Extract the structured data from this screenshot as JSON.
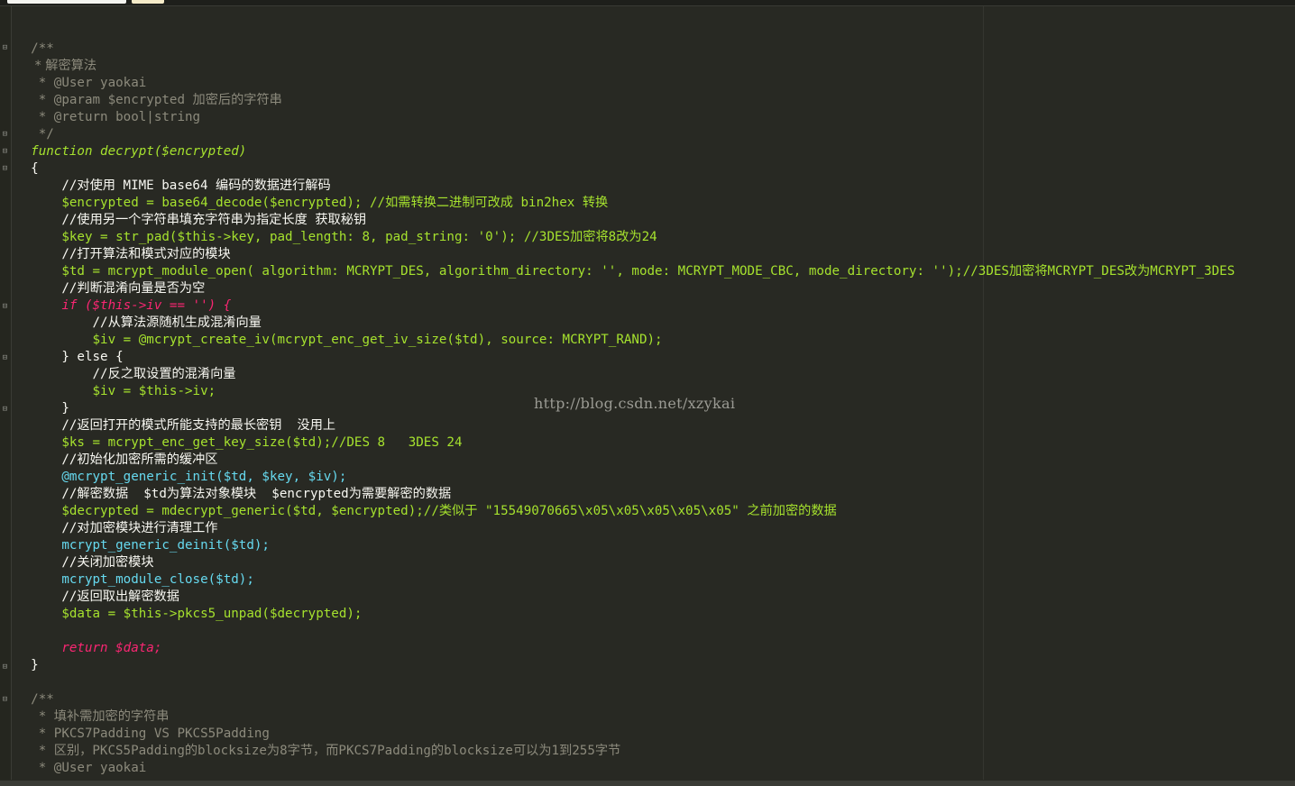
{
  "editor": {
    "tabs": [
      "",
      ""
    ],
    "watermark": "http://blog.csdn.net/xzykai"
  },
  "code": {
    "lines": [
      "/**",
      " * 解密算法",
      " * @User yaokai",
      " * @param $encrypted 加密后的字符串",
      " * @return bool|string",
      " */",
      "function decrypt($encrypted)",
      "{",
      "    //对使用 MIME base64 编码的数据进行解码",
      "    $encrypted = base64_decode($encrypted); //如需转换二进制可改成 bin2hex 转换",
      "    //使用另一个字符串填充字符串为指定长度 获取秘钥",
      "    $key = str_pad($this->key, pad_length: 8, pad_string: '0'); //3DES加密将8改为24",
      "    //打开算法和模式对应的模块",
      "    $td = mcrypt_module_open( algorithm: MCRYPT_DES, algorithm_directory: '', mode: MCRYPT_MODE_CBC, mode_directory: '');//3DES加密将MCRYPT_DES改为MCRYPT_3DES",
      "    //判断混淆向量是否为空",
      "    if ($this->iv == '') {",
      "        //从算法源随机生成混淆向量",
      "        $iv = @mcrypt_create_iv(mcrypt_enc_get_iv_size($td), source: MCRYPT_RAND);",
      "    } else {",
      "        //反之取设置的混淆向量",
      "        $iv = $this->iv;",
      "    }",
      "    //返回打开的模式所能支持的最长密钥  没用上",
      "    $ks = mcrypt_enc_get_key_size($td);//DES 8   3DES 24",
      "    //初始化加密所需的缓冲区",
      "    @mcrypt_generic_init($td, $key, $iv);",
      "    //解密数据  $td为算法对象模块  $encrypted为需要解密的数据",
      "    $decrypted = mdecrypt_generic($td, $encrypted);//类似于 \"15549070665\\x05\\x05\\x05\\x05\\x05\" 之前加密的数据",
      "    //对加密模块进行清理工作",
      "    mcrypt_generic_deinit($td);",
      "    //关闭加密模块",
      "    mcrypt_module_close($td);",
      "    //返回取出解密数据",
      "    $data = $this->pkcs5_unpad($decrypted);",
      "",
      "    return $data;",
      "}",
      "",
      "/**",
      " * 填补需加密的字符串",
      " * PKCS7Padding VS PKCS5Padding",
      " * 区别，PKCS5Padding的blocksize为8字节，而PKCS7Padding的blocksize可以为1到255字节",
      " * @User yaokai"
    ]
  },
  "colors": {
    "background": "#282923",
    "comment": "#8c8a7c",
    "keyword": "#f92672",
    "function": "#a6e22e",
    "builtin": "#66d9ef",
    "string": "#e6db74",
    "constant": "#ae81ff",
    "variable": "#fd971f"
  }
}
